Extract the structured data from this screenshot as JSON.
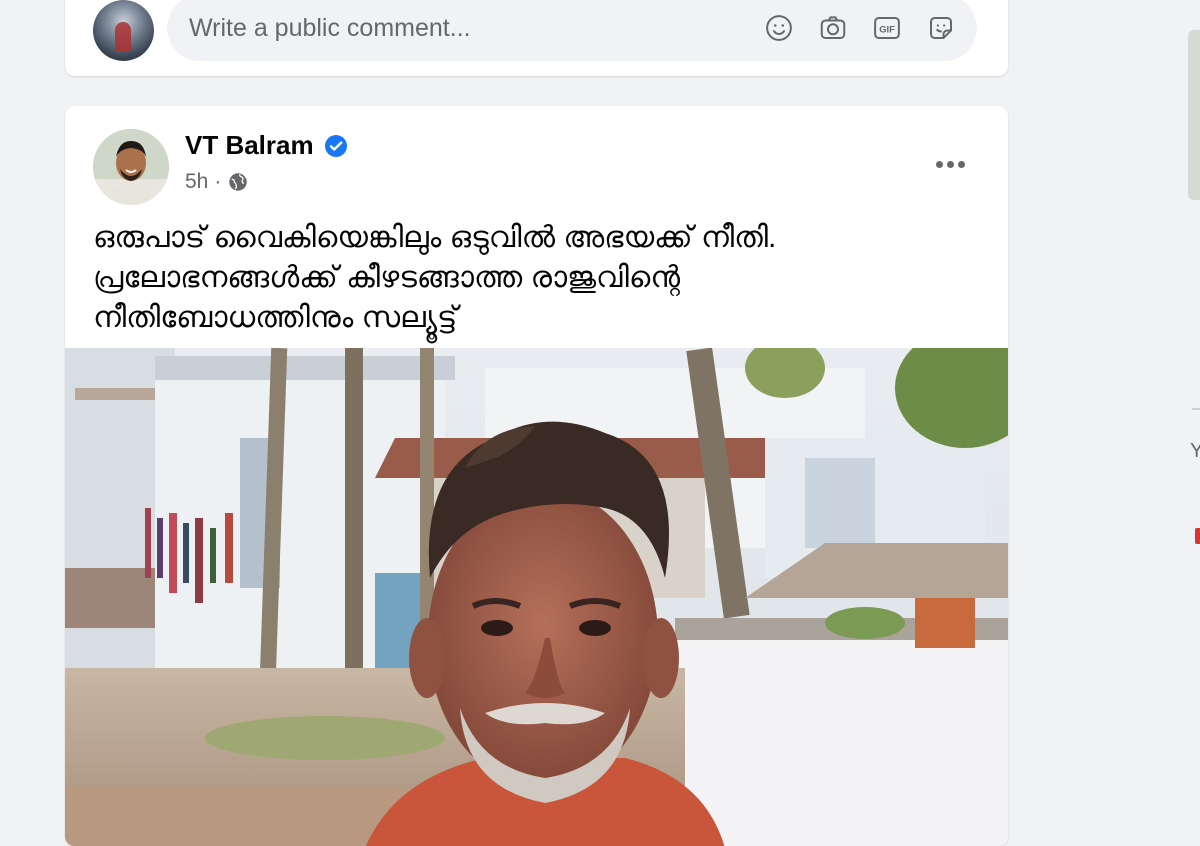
{
  "comment_box": {
    "placeholder": "Write a public comment...",
    "tools": [
      "emoji-icon",
      "camera-icon",
      "gif-icon",
      "sticker-icon"
    ],
    "gif_label": "GIF"
  },
  "post": {
    "author": "VT Balram",
    "verified": true,
    "time": "5h",
    "separator": "·",
    "privacy": "public-globe-icon",
    "text_lines": [
      "ഒരുപാട് വൈകിയെങ്കിലും ഒടുവിൽ അഭയക്ക് നീതി.",
      "പ്രലോഭനങ്ങൾക്ക് കീഴടങ്ങാത്ത രാജുവിന്റെ",
      "നീതിബോധത്തിനും സല്യൂട്ട്"
    ]
  },
  "right_edge": {
    "letter": "Y"
  },
  "colors": {
    "background": "#f0f2f5",
    "card": "#ffffff",
    "secondary_text": "#65676b",
    "verified_blue": "#1877f2"
  }
}
